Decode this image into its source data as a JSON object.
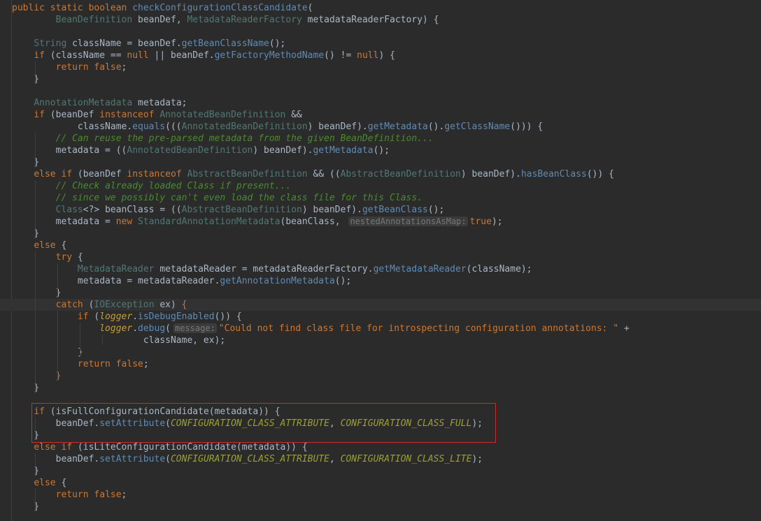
{
  "colors": {
    "background": "#2b2b2b",
    "keyword": "#cc7832",
    "plain": "#a9b7c6",
    "type": "#507874",
    "method": "#5f8bb5",
    "comment": "#629755",
    "string": "#6a8759",
    "constant": "#9876aa",
    "static_field": "#9876aa",
    "highlight_border": "#d12a2a"
  },
  "code": {
    "lines": [
      {
        "n": 0,
        "t": [
          [
            "k",
            "public static boolean "
          ],
          [
            "m",
            "checkConfigurationClassCandidate"
          ],
          [
            "p",
            "("
          ]
        ]
      },
      {
        "n": 1,
        "t": [
          [
            "p",
            "        "
          ],
          [
            "y",
            "BeanDefinition"
          ],
          [
            "p",
            " beanDef, "
          ],
          [
            "y",
            "MetadataReaderFactory"
          ],
          [
            "p",
            " metadataReaderFactory) {"
          ]
        ]
      },
      {
        "n": 2,
        "t": [
          [
            "p",
            ""
          ]
        ]
      },
      {
        "n": 3,
        "t": [
          [
            "p",
            "    "
          ],
          [
            "y",
            "String"
          ],
          [
            "p",
            " className = beanDef."
          ],
          [
            "m",
            "getBeanClassName"
          ],
          [
            "p",
            "();"
          ]
        ]
      },
      {
        "n": 4,
        "t": [
          [
            "p",
            "    "
          ],
          [
            "k",
            "if"
          ],
          [
            "p",
            " (className == "
          ],
          [
            "k",
            "null"
          ],
          [
            "p",
            " || beanDef."
          ],
          [
            "m",
            "getFactoryMethodName"
          ],
          [
            "p",
            "() != "
          ],
          [
            "k",
            "null"
          ],
          [
            "p",
            ") {"
          ]
        ]
      },
      {
        "n": 5,
        "t": [
          [
            "p",
            "        "
          ],
          [
            "k",
            "return false"
          ],
          [
            "p",
            ";"
          ]
        ]
      },
      {
        "n": 6,
        "t": [
          [
            "p",
            "    }"
          ]
        ]
      },
      {
        "n": 7,
        "t": [
          [
            "p",
            ""
          ]
        ]
      },
      {
        "n": 8,
        "t": [
          [
            "p",
            "    "
          ],
          [
            "y",
            "AnnotationMetadata"
          ],
          [
            "p",
            " metadata;"
          ]
        ]
      },
      {
        "n": 9,
        "t": [
          [
            "p",
            "    "
          ],
          [
            "k",
            "if"
          ],
          [
            "p",
            " (beanDef "
          ],
          [
            "k",
            "instanceof"
          ],
          [
            "p",
            " "
          ],
          [
            "y",
            "AnnotatedBeanDefinition"
          ],
          [
            "p",
            " &&"
          ]
        ]
      },
      {
        "n": 10,
        "t": [
          [
            "p",
            "            className."
          ],
          [
            "m",
            "equals"
          ],
          [
            "p",
            "((("
          ],
          [
            "y",
            "AnnotatedBeanDefinition"
          ],
          [
            "p",
            ") beanDef)."
          ],
          [
            "m",
            "getMetadata"
          ],
          [
            "p",
            "()."
          ],
          [
            "m",
            "getClassName"
          ],
          [
            "p",
            "())) {"
          ]
        ]
      },
      {
        "n": 11,
        "t": [
          [
            "p",
            "        "
          ],
          [
            "c",
            "// Can reuse the pre-parsed metadata from the given BeanDefinition..."
          ]
        ]
      },
      {
        "n": 12,
        "t": [
          [
            "p",
            "        metadata = (("
          ],
          [
            "y",
            "AnnotatedBeanDefinition"
          ],
          [
            "p",
            ") beanDef)."
          ],
          [
            "m",
            "getMetadata"
          ],
          [
            "p",
            "();"
          ]
        ]
      },
      {
        "n": 13,
        "t": [
          [
            "p",
            "    }"
          ]
        ]
      },
      {
        "n": 14,
        "t": [
          [
            "p",
            "    "
          ],
          [
            "k",
            "else if"
          ],
          [
            "p",
            " (beanDef "
          ],
          [
            "k",
            "instanceof"
          ],
          [
            "p",
            " "
          ],
          [
            "y",
            "AbstractBeanDefinition"
          ],
          [
            "p",
            " && (("
          ],
          [
            "y",
            "AbstractBeanDefinition"
          ],
          [
            "p",
            ") beanDef)."
          ],
          [
            "m",
            "hasBeanClass"
          ],
          [
            "p",
            "()) {"
          ]
        ]
      },
      {
        "n": 15,
        "t": [
          [
            "p",
            "        "
          ],
          [
            "c",
            "// Check already loaded Class if present..."
          ]
        ]
      },
      {
        "n": 16,
        "t": [
          [
            "p",
            "        "
          ],
          [
            "c",
            "// since we possibly can't even load the class file for this Class."
          ]
        ]
      },
      {
        "n": 17,
        "t": [
          [
            "p",
            "        "
          ],
          [
            "y",
            "Class"
          ],
          [
            "p",
            "<?> beanClass = (("
          ],
          [
            "y",
            "AbstractBeanDefinition"
          ],
          [
            "p",
            ") beanDef)."
          ],
          [
            "m",
            "getBeanClass"
          ],
          [
            "p",
            "();"
          ]
        ]
      },
      {
        "n": 18,
        "t": [
          [
            "p",
            "        metadata = "
          ],
          [
            "k",
            "new"
          ],
          [
            "p",
            " "
          ],
          [
            "y",
            "StandardAnnotationMetadata"
          ],
          [
            "p",
            "(beanClass, "
          ],
          [
            "h",
            "nestedAnnotationsAsMap:"
          ],
          [
            "k",
            "true"
          ],
          [
            "p",
            ");"
          ]
        ]
      },
      {
        "n": 19,
        "t": [
          [
            "p",
            "    }"
          ]
        ]
      },
      {
        "n": 20,
        "t": [
          [
            "p",
            "    "
          ],
          [
            "k",
            "else"
          ],
          [
            "p",
            " {"
          ]
        ]
      },
      {
        "n": 21,
        "t": [
          [
            "p",
            "        "
          ],
          [
            "k",
            "try"
          ],
          [
            "p",
            " {"
          ]
        ]
      },
      {
        "n": 22,
        "t": [
          [
            "p",
            "            "
          ],
          [
            "y",
            "MetadataReader"
          ],
          [
            "p",
            " metadataReader = metadataReaderFactory."
          ],
          [
            "m",
            "getMetadataReader"
          ],
          [
            "p",
            "(className);"
          ]
        ]
      },
      {
        "n": 23,
        "t": [
          [
            "p",
            "            metadata = metadataReader."
          ],
          [
            "m",
            "getAnnotationMetadata"
          ],
          [
            "p",
            "();"
          ]
        ]
      },
      {
        "n": 24,
        "t": [
          [
            "p",
            "        }"
          ]
        ]
      },
      {
        "n": 25,
        "t": [
          [
            "p",
            "        "
          ],
          [
            "k",
            "catch"
          ],
          [
            "p",
            " ("
          ],
          [
            "y",
            "IOException"
          ],
          [
            "p",
            " ex) "
          ],
          [
            "k",
            "{"
          ]
        ]
      },
      {
        "n": 26,
        "t": [
          [
            "p",
            "            "
          ],
          [
            "k",
            "if"
          ],
          [
            "p",
            " ("
          ],
          [
            "s",
            "logger"
          ],
          [
            "p",
            "."
          ],
          [
            "m",
            "isDebugEnabled"
          ],
          [
            "p",
            "()) {"
          ]
        ]
      },
      {
        "n": 27,
        "t": [
          [
            "p",
            "                "
          ],
          [
            "s",
            "logger"
          ],
          [
            "p",
            "."
          ],
          [
            "m",
            "debug"
          ],
          [
            "p",
            "("
          ],
          [
            "h",
            "message:"
          ],
          [
            "g",
            "\"Could not find class file for introspecting configuration annotations: \""
          ],
          [
            "p",
            " +"
          ]
        ]
      },
      {
        "n": 28,
        "t": [
          [
            "p",
            "                        className, ex);"
          ]
        ]
      },
      {
        "n": 29,
        "t": [
          [
            "p",
            "            }"
          ]
        ]
      },
      {
        "n": 30,
        "t": [
          [
            "p",
            "            "
          ],
          [
            "k",
            "return false"
          ],
          [
            "p",
            ";"
          ]
        ]
      },
      {
        "n": 31,
        "t": [
          [
            "p",
            "        "
          ],
          [
            "k",
            "}"
          ]
        ]
      },
      {
        "n": 32,
        "t": [
          [
            "p",
            "    }"
          ]
        ]
      },
      {
        "n": 33,
        "t": [
          [
            "p",
            ""
          ]
        ]
      },
      {
        "n": 34,
        "t": [
          [
            "p",
            "    "
          ],
          [
            "k",
            "if"
          ],
          [
            "p",
            " (isFullConfigurationCandidate(metadata)) {"
          ]
        ]
      },
      {
        "n": 35,
        "t": [
          [
            "p",
            "        beanDef."
          ],
          [
            "m",
            "setAttribute"
          ],
          [
            "p",
            "("
          ],
          [
            "x",
            "CONFIGURATION_CLASS_ATTRIBUTE"
          ],
          [
            "p",
            ", "
          ],
          [
            "x",
            "CONFIGURATION_CLASS_FULL"
          ],
          [
            "p",
            ");"
          ]
        ]
      },
      {
        "n": 36,
        "t": [
          [
            "p",
            "    }"
          ]
        ]
      },
      {
        "n": 37,
        "t": [
          [
            "p",
            "    "
          ],
          [
            "k",
            "else if"
          ],
          [
            "p",
            " (isLiteConfigurationCandidate(metadata)) {"
          ]
        ]
      },
      {
        "n": 38,
        "t": [
          [
            "p",
            "        beanDef."
          ],
          [
            "m",
            "setAttribute"
          ],
          [
            "p",
            "("
          ],
          [
            "x",
            "CONFIGURATION_CLASS_ATTRIBUTE"
          ],
          [
            "p",
            ", "
          ],
          [
            "x",
            "CONFIGURATION_CLASS_LITE"
          ],
          [
            "p",
            ");"
          ]
        ]
      },
      {
        "n": 39,
        "t": [
          [
            "p",
            "    }"
          ]
        ]
      },
      {
        "n": 40,
        "t": [
          [
            "p",
            "    "
          ],
          [
            "k",
            "else"
          ],
          [
            "p",
            " {"
          ]
        ]
      },
      {
        "n": 41,
        "t": [
          [
            "p",
            "        "
          ],
          [
            "k",
            "return false"
          ],
          [
            "p",
            ";"
          ]
        ]
      },
      {
        "n": 42,
        "t": [
          [
            "p",
            "    }"
          ]
        ]
      }
    ]
  }
}
